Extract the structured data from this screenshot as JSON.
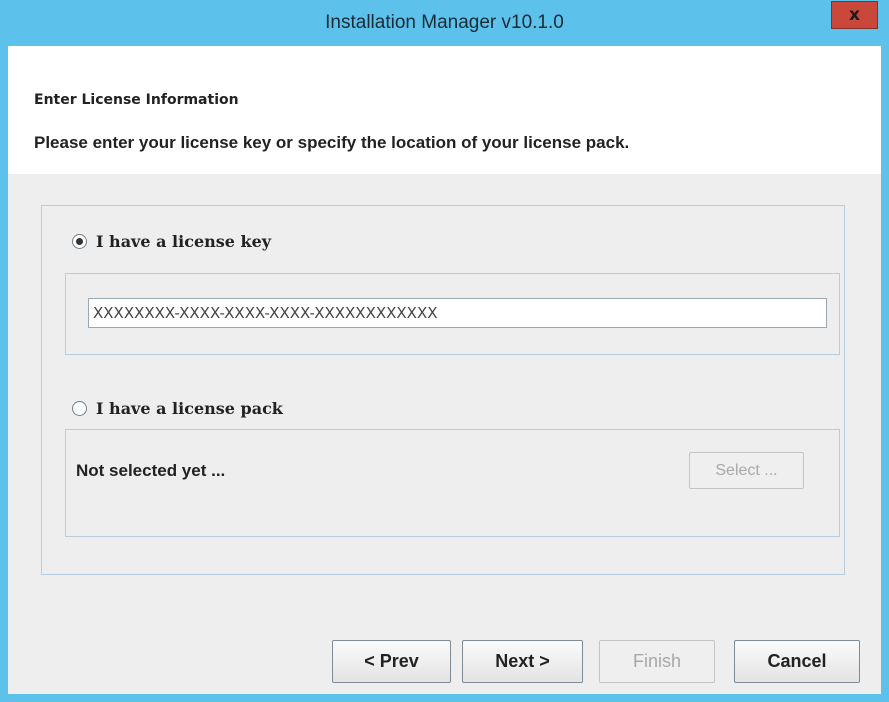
{
  "window": {
    "title": "Installation Manager v10.1.0",
    "close_glyph": "x"
  },
  "header": {
    "title": "Enter License Information",
    "description": "Please enter your license key or specify the location of your license pack."
  },
  "license_key": {
    "label": "I have a license key",
    "selected": true,
    "value": "XXXXXXXX-XXXX-XXXX-XXXX-XXXXXXXXXXXX"
  },
  "license_pack": {
    "label": "I have a license pack",
    "selected": false,
    "status": "Not selected yet ...",
    "select_label": "Select ..."
  },
  "footer": {
    "prev_label": "< Prev",
    "next_label": "Next >",
    "finish_label": "Finish",
    "cancel_label": "Cancel"
  },
  "colors": {
    "titlebar": "#5cc2ec",
    "close_button": "#c9483a",
    "content_background": "#eeeeee",
    "group_border": "#b8cde0"
  }
}
